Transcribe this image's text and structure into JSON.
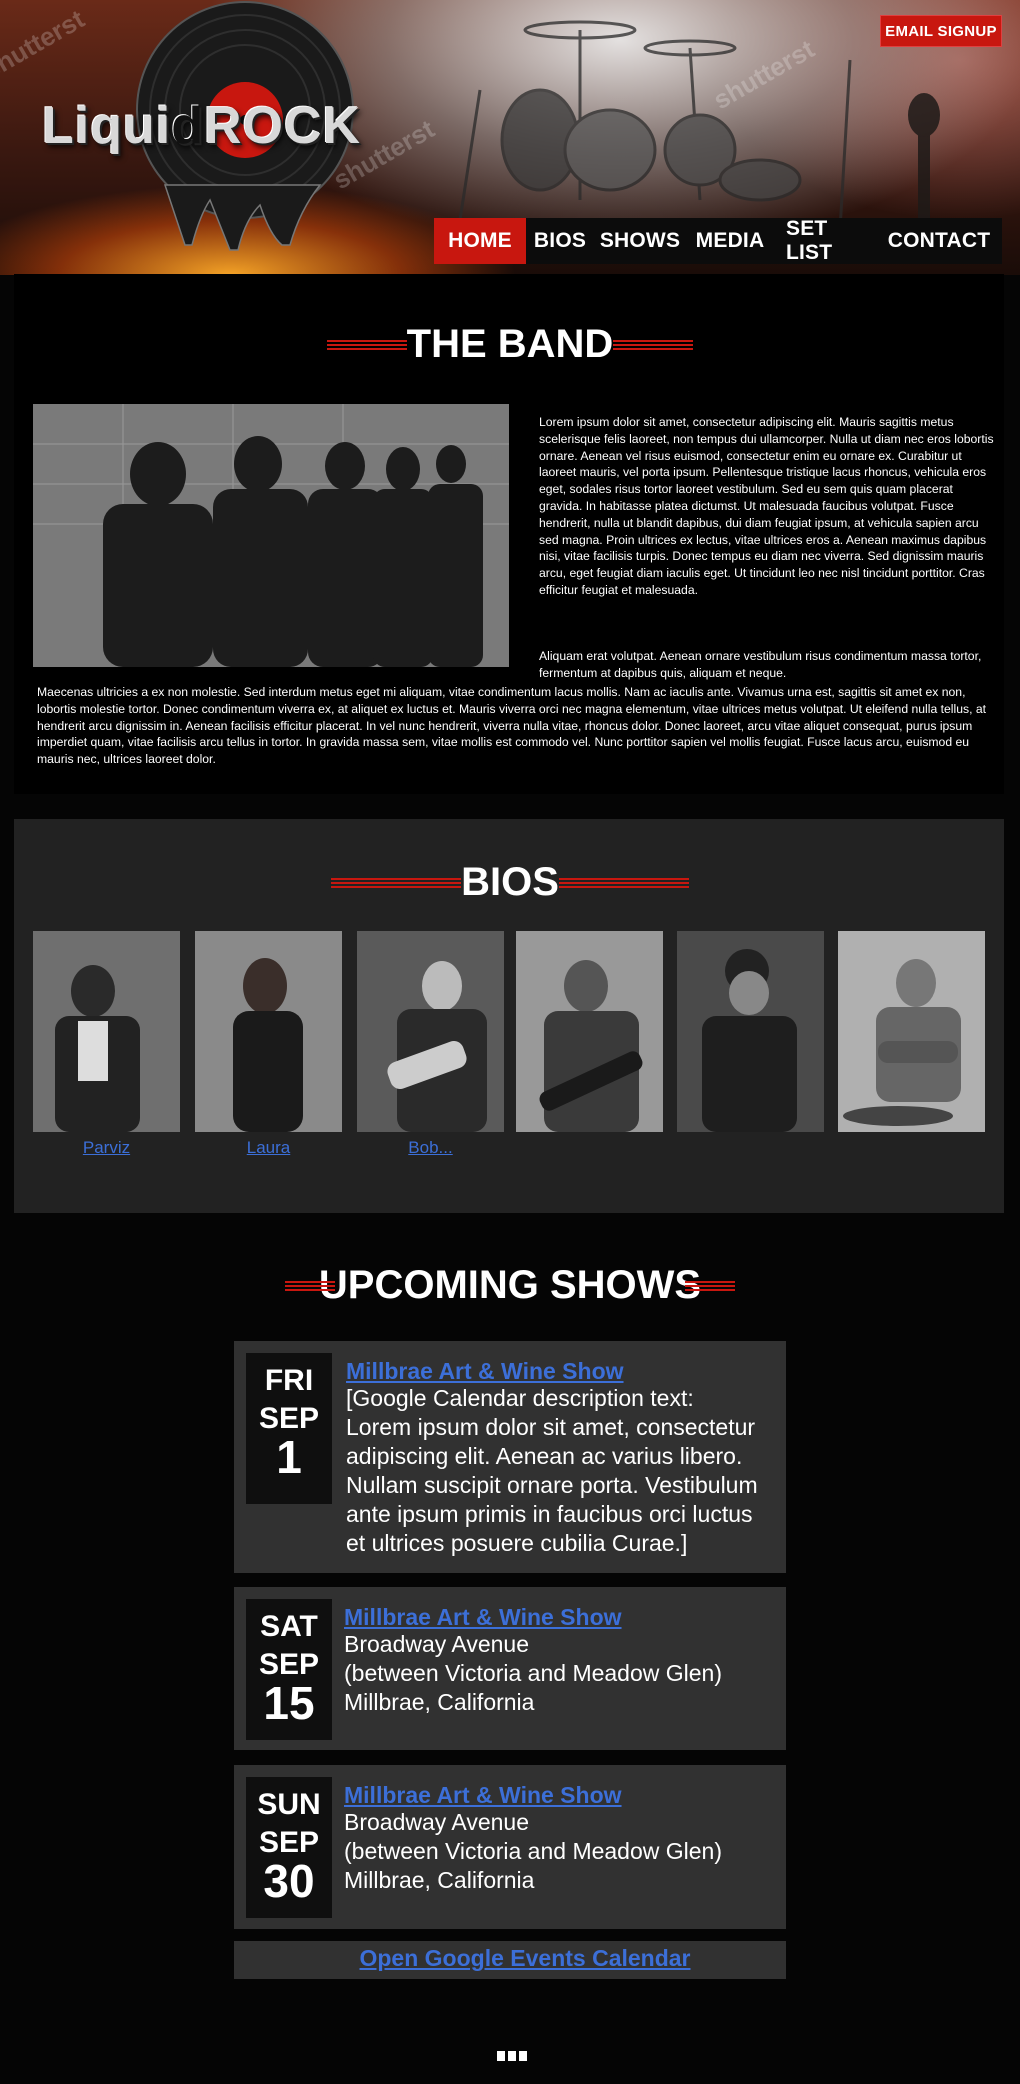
{
  "header": {
    "logo": {
      "part1": "Liqui",
      "part2": "ROCK",
      "letter": "d"
    },
    "email_signup": "EMAIL SIGNUP"
  },
  "nav": {
    "items": [
      {
        "label": "HOME",
        "active": true
      },
      {
        "label": "BIOS",
        "active": false
      },
      {
        "label": "SHOWS",
        "active": false
      },
      {
        "label": "MEDIA",
        "active": false
      },
      {
        "label": "SET LIST",
        "active": false
      },
      {
        "label": "CONTACT",
        "active": false
      }
    ]
  },
  "band": {
    "title": "THE BAND",
    "text1": "Lorem ipsum dolor sit amet, consectetur adipiscing elit. Mauris sagittis metus scelerisque felis laoreet, non tempus dui ullamcorper. Nulla ut diam nec eros lobortis ornare. Aenean vel risus euismod, consectetur enim eu ornare ex. Curabitur ut laoreet mauris, vel porta ipsum. Pellentesque tristique lacus rhoncus, vehicula eros eget, sodales risus tortor laoreet vestibulum. Sed eu sem quis quam placerat gravida. In habitasse platea dictumst. Ut malesuada faucibus volutpat. Fusce hendrerit, nulla ut blandit dapibus, dui diam feugiat ipsum, at vehicula sapien arcu sed magna. Proin ultrices ex lectus, vitae ultrices eros a. Aenean maximus dapibus nisi, vitae facilisis turpis. Donec tempus eu diam nec viverra. Sed dignissim mauris arcu, eget feugiat diam iaculis eget. Ut tincidunt leo nec nisl tincidunt porttitor. Cras efficitur feugiat et malesuada.",
    "text2a": "Aliquam erat volutpat. Aenean ornare vestibulum risus condimentum massa tortor, fermentum at dapibus quis, aliquam et neque.",
    "text2b": "Maecenas ultricies a ex non molestie. Sed interdum metus eget mi aliquam, vitae condimentum lacus mollis. Nam ac iaculis ante. Vivamus urna est, sagittis sit amet ex non, lobortis molestie tortor. Donec condimentum viverra ex, at aliquet ex luctus et. Mauris viverra orci nec magna elementum, vitae ultrices metus volutpat.  Ut eleifend nulla tellus, at hendrerit arcu dignissim in. Aenean facilisis efficitur placerat. In vel nunc hendrerit, viverra nulla vitae, rhoncus dolor. Donec laoreet, arcu vitae aliquet consequat, purus ipsum imperdiet quam, vitae facilisis arcu tellus in tortor. In gravida massa sem, vitae mollis est commodo vel. Nunc porttitor sapien vel mollis feugiat. Fusce lacus arcu, euismod eu mauris nec, ultrices laoreet dolor."
  },
  "bios": {
    "title": "BIOS",
    "members": [
      {
        "name": "Parviz"
      },
      {
        "name": "Laura"
      },
      {
        "name": "Bob..."
      },
      {
        "name": ""
      },
      {
        "name": ""
      },
      {
        "name": ""
      }
    ]
  },
  "shows": {
    "title": "UPCOMING SHOWS",
    "events": [
      {
        "dow": "FRI",
        "month": "SEP",
        "day": "1",
        "title": "Millbrae Art & Wine Show",
        "lines": [
          "[Google Calendar description text:",
          "Lorem ipsum dolor sit amet, consectetur",
          "adipiscing elit. Aenean ac varius libero.",
          "Nullam suscipit ornare porta. Vestibulum",
          "ante ipsum primis in faucibus orci luctus",
          "et ultrices posuere cubilia Curae.]"
        ]
      },
      {
        "dow": "SAT",
        "month": "SEP",
        "day": "15",
        "title": "Millbrae Art & Wine Show",
        "lines": [
          "Broadway Avenue",
          "(between Victoria and Meadow Glen)",
          "Millbrae, California"
        ]
      },
      {
        "dow": "SUN",
        "month": "SEP",
        "day": "30",
        "title": "Millbrae Art & Wine Show",
        "lines": [
          "Broadway Avenue",
          "(between Victoria and Meadow Glen)",
          "Millbrae, California"
        ]
      }
    ],
    "calendar_link": "Open Google Events Calendar"
  },
  "colors": {
    "accent": "#c8170f",
    "link": "#3c6fd8",
    "card": "#313131",
    "bios_bg": "#222222"
  }
}
